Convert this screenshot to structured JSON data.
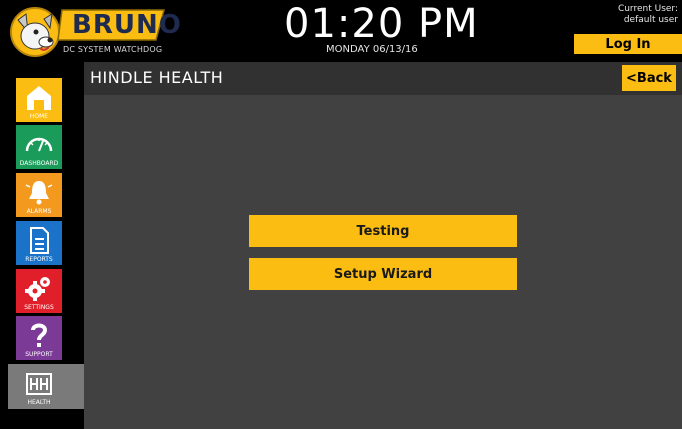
{
  "header": {
    "brand_name": "BRUNO",
    "brand_subtitle": "DC SYSTEM WATCHDOG",
    "time": "01:20 PM",
    "date": "MONDAY 06/13/16",
    "current_user_label": "Current User:",
    "current_user_name": "default user",
    "login_label": "Log In"
  },
  "sidebar": {
    "items": [
      {
        "label": "HOME",
        "icon": "home-icon",
        "color": "#fbbd12"
      },
      {
        "label": "DASHBOARD",
        "icon": "gauge-icon",
        "color": "#1a9b5a"
      },
      {
        "label": "ALARMS",
        "icon": "bell-icon",
        "color": "#f39a1e"
      },
      {
        "label": "REPORTS",
        "icon": "document-icon",
        "color": "#1a73c8"
      },
      {
        "label": "SETTINGS",
        "icon": "gears-icon",
        "color": "#e11f2a"
      },
      {
        "label": "SUPPORT",
        "icon": "question-icon",
        "color": "#7b3a96"
      },
      {
        "label": "HEALTH",
        "icon": "health-icon",
        "color": "#7a7a7a"
      }
    ]
  },
  "main": {
    "title": "HINDLE HEALTH",
    "back_label": "<Back",
    "buttons": [
      {
        "label": "Testing"
      },
      {
        "label": "Setup Wizard"
      }
    ]
  },
  "colors": {
    "accent": "#fbbd12",
    "panel": "#414141",
    "titlebar": "#313131"
  }
}
